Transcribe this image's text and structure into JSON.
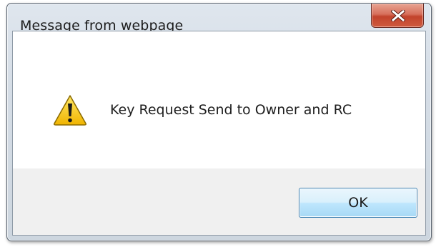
{
  "window": {
    "title": "Message from webpage"
  },
  "titlebar": {
    "close_icon": "close-x-icon",
    "close_color": "#c7442d"
  },
  "dialog": {
    "icon": "warning-icon",
    "message": "Key Request Send to Owner and RC"
  },
  "buttons": {
    "ok_label": "OK"
  },
  "colors": {
    "warning_fill": "#f5c400",
    "button_border": "#3c7fb1",
    "footer_bg": "#f0f0f0"
  }
}
